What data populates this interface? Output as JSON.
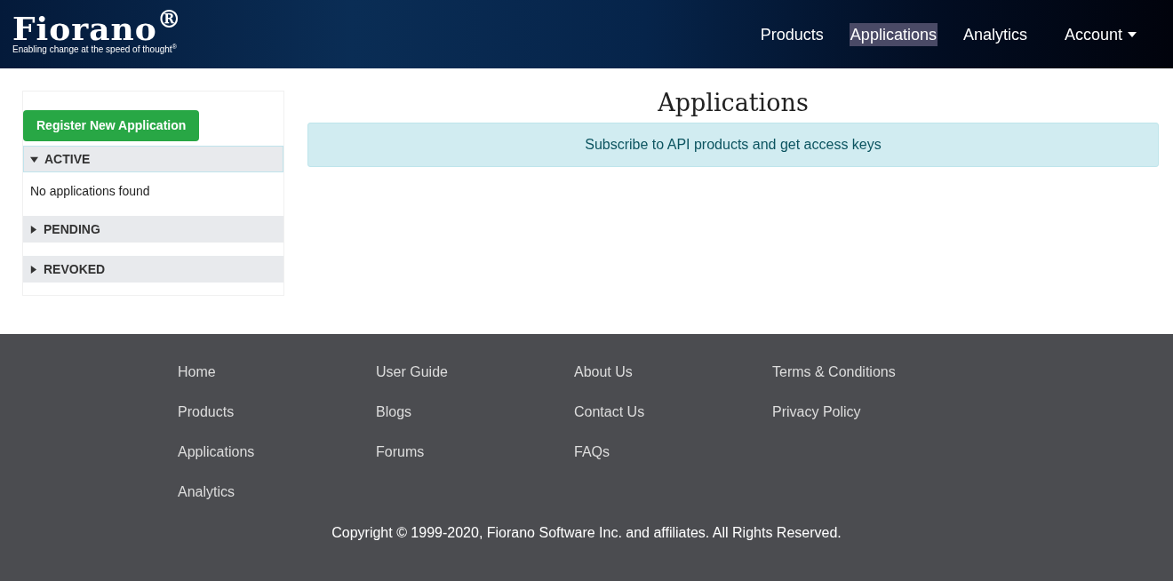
{
  "header": {
    "logo": "Fiorano$^{®}$",
    "tagline": "Enabling change at the speed of thought$^{®}$",
    "nav": [
      {
        "label": "Products",
        "selected": false,
        "dropdown": false
      },
      {
        "label": "Applications",
        "selected": true,
        "dropdown": false
      },
      {
        "label": "Analytics",
        "selected": false,
        "dropdown": false
      },
      {
        "label": "Account",
        "selected": false,
        "dropdown": true
      }
    ]
  },
  "sidebar": {
    "register_button": "Register New Application",
    "sections": [
      {
        "label": "ACTIVE",
        "expanded": true,
        "content": "No applications found"
      },
      {
        "label": "PENDING",
        "expanded": false
      },
      {
        "label": "REVOKED",
        "expanded": false
      }
    ]
  },
  "main": {
    "title": "Applications",
    "info": "Subscribe to API products and get access keys"
  },
  "footer": {
    "columns": [
      [
        "Home",
        "Products",
        "Applications",
        "Analytics"
      ],
      [
        "User Guide",
        "Blogs",
        "Forums"
      ],
      [
        "About Us",
        "Contact Us",
        "FAQs"
      ],
      [
        "Terms & Conditions",
        "Privacy Policy"
      ]
    ],
    "copyright": "Copyright © 1999-2020, Fiorano Software Inc. and affiliates. All Rights Reserved."
  }
}
